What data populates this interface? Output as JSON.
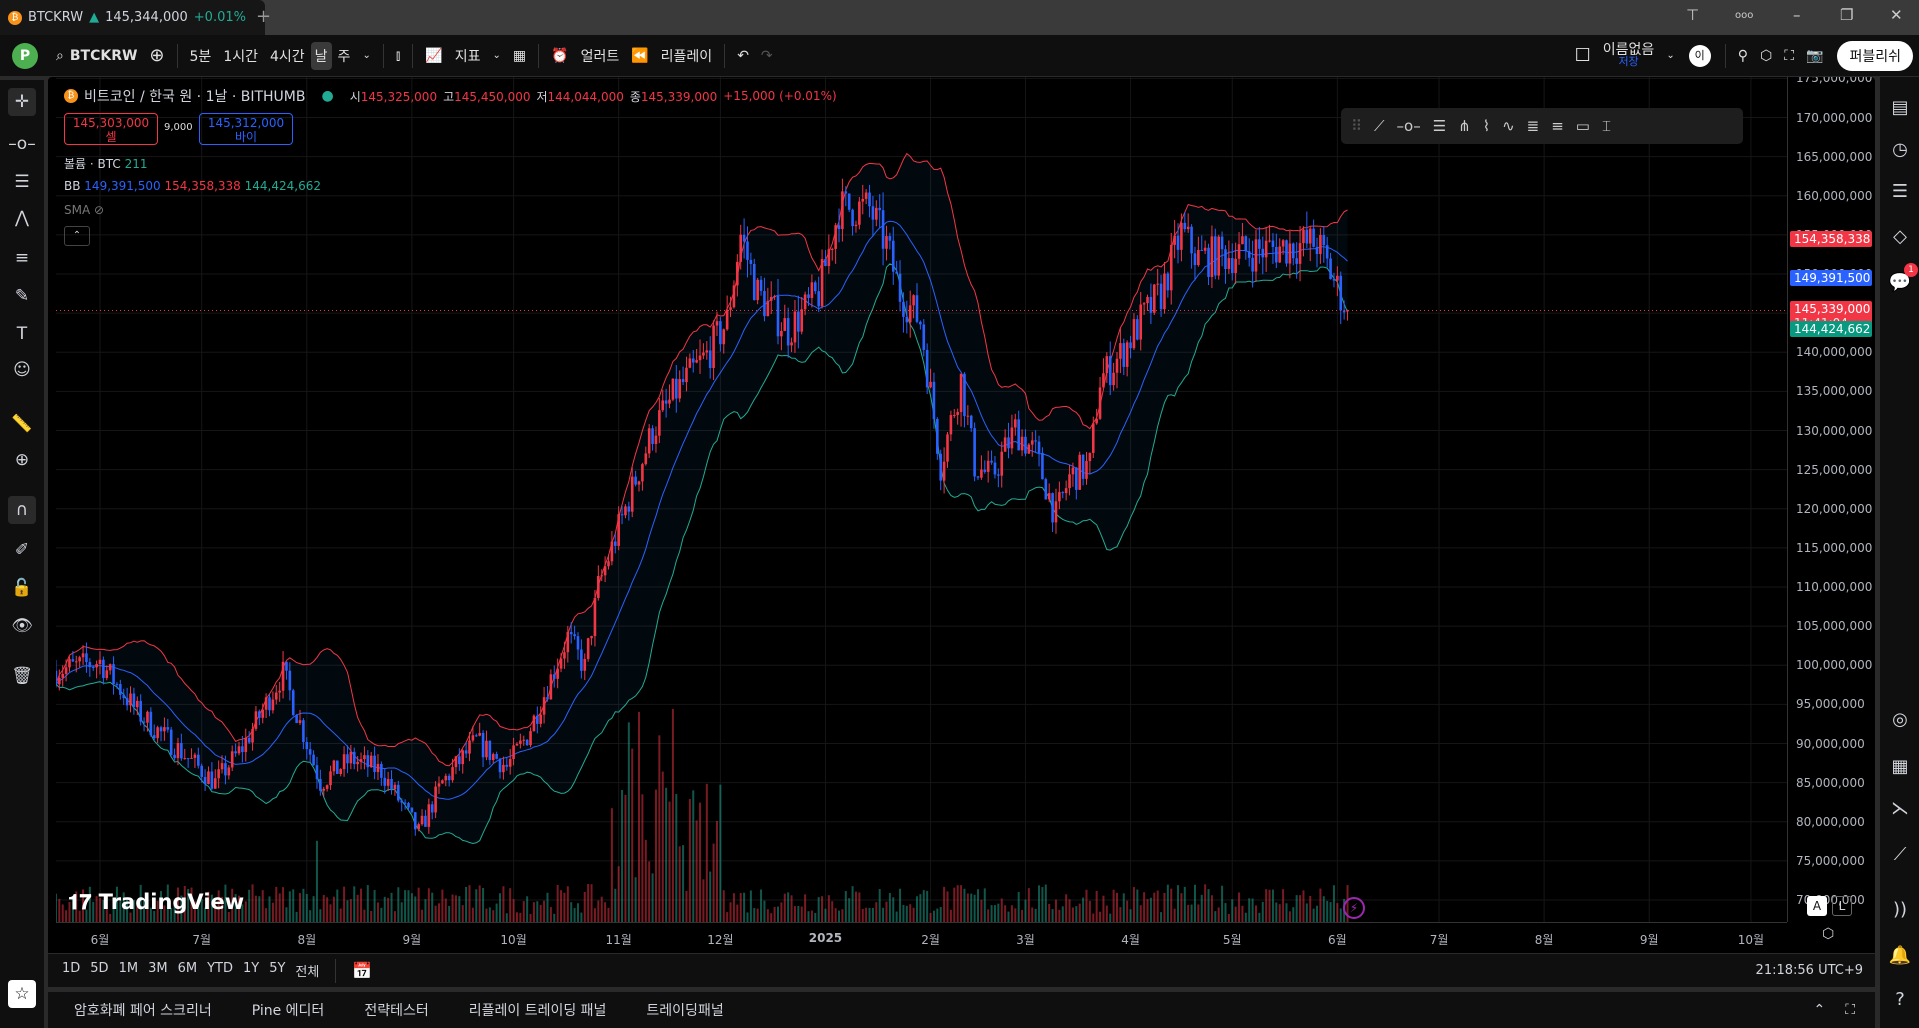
{
  "titlebar": {
    "symbol": "BTCKRW",
    "price": "145,344,000",
    "change": "+0.01%",
    "new_tab": "+",
    "win": {
      "min": "–",
      "max": "❐",
      "close": "✕",
      "more": "ooo"
    }
  },
  "toolbar": {
    "avatar": "P",
    "symbol": "BTCKRW",
    "intervals": [
      "5분",
      "1시간",
      "4시간",
      "날",
      "주"
    ],
    "active_interval": "날",
    "indicators": "지표",
    "alert": "얼러트",
    "replay": "리플레이",
    "layout_name": "이름없음",
    "layout_save": "저장",
    "user_initial": "이",
    "publish": "퍼블리쉬"
  },
  "legend": {
    "title": "비트코인 / 한국 원 · 1날 · BITHUMB",
    "o_label": "시",
    "o": "145,325,000",
    "h_label": "고",
    "h": "145,450,000",
    "l_label": "저",
    "l": "144,044,000",
    "c_label": "종",
    "c": "145,339,000",
    "chg": "+15,000 (+0.01%)",
    "sell_price": "145,303,000",
    "sell_label": "셀",
    "spread": "9,000",
    "buy_price": "145,312,000",
    "buy_label": "바이",
    "volume_label": "볼륨 · BTC",
    "volume_value": "211",
    "bb_label": "BB",
    "bb_basis": "149,391,500",
    "bb_upper": "154,358,338",
    "bb_lower": "144,424,662",
    "sma_label": "SMA"
  },
  "price_axis": {
    "labels": [
      "175,000,000",
      "170,000,000",
      "165,000,000",
      "160,000,000",
      "155,000,000",
      "150,000,000",
      "145,000,000",
      "140,000,000",
      "135,000,000",
      "130,000,000",
      "125,000,000",
      "120,000,000",
      "115,000,000",
      "110,000,000",
      "105,000,000",
      "100,000,000",
      "95,000,000",
      "90,000,000",
      "85,000,000",
      "80,000,000",
      "75,000,000",
      "70,000,000"
    ],
    "badge_upper": "154,358,338",
    "badge_basis": "149,391,500",
    "badge_last": "145,339,000",
    "badge_countdown": "11:41:04",
    "badge_lower": "144,424,662",
    "auto": "A",
    "log": "L"
  },
  "time_axis": {
    "labels": [
      "6월",
      "7월",
      "8월",
      "9월",
      "10월",
      "11월",
      "12월",
      "2025",
      "2월",
      "3월",
      "4월",
      "5월",
      "6월",
      "7월",
      "8월",
      "9월",
      "10월"
    ]
  },
  "range_bar": {
    "ranges": [
      "1D",
      "5D",
      "1M",
      "3M",
      "6M",
      "YTD",
      "1Y",
      "5Y",
      "전체"
    ],
    "clock": "21:18:56 UTC+9"
  },
  "bottom_tabs": [
    "암호화폐 페어 스크리너",
    "Pine 에디터",
    "전략테스터",
    "리플레이 트레이딩 패널",
    "트레이딩패널"
  ],
  "right_sidebar": {
    "notification_badge": "1"
  },
  "watermark": "TradingView",
  "colors": {
    "up": "#f23645",
    "down": "#2962ff",
    "bb_upper": "#f23645",
    "bb_basis": "#2962ff",
    "bb_lower": "#22ab94"
  },
  "chart_data": {
    "type": "candlestick",
    "interval": "1D",
    "units": "KRW (millions)",
    "ylim": [
      67,
      177
    ],
    "path": [
      [
        "2024-05-19",
        99.3
      ],
      [
        "2024-06-01",
        100.5
      ],
      [
        "2024-06-12",
        94
      ],
      [
        "2024-07-05",
        85
      ],
      [
        "2024-07-13",
        89.5
      ],
      [
        "2024-07-25",
        99
      ],
      [
        "2024-08-05",
        85
      ],
      [
        "2024-08-14",
        88
      ],
      [
        "2024-08-23",
        86.5
      ],
      [
        "2024-09-03",
        78.6
      ],
      [
        "2024-09-10",
        85
      ],
      [
        "2024-09-20",
        90.3
      ],
      [
        "2024-09-29",
        87
      ],
      [
        "2024-10-05",
        91
      ],
      [
        "2024-10-17",
        103.6
      ],
      [
        "2024-10-22",
        99.7
      ],
      [
        "2024-10-26",
        110
      ],
      [
        "2024-11-11",
        130
      ],
      [
        "2024-11-18",
        135
      ],
      [
        "2024-11-27",
        139.6
      ],
      [
        "2024-12-03",
        144
      ],
      [
        "2024-12-07",
        155
      ],
      [
        "2024-12-12",
        147.5
      ],
      [
        "2024-12-21",
        142.8
      ],
      [
        "2024-12-30",
        147.5
      ],
      [
        "2025-01-05",
        158.4
      ],
      [
        "2025-01-14",
        158.4
      ],
      [
        "2025-01-19",
        153.7
      ],
      [
        "2025-01-23",
        147.5
      ],
      [
        "2025-01-29",
        144
      ],
      [
        "2025-02-04",
        125.6
      ],
      [
        "2025-02-10",
        136.5
      ],
      [
        "2025-02-14",
        125.6
      ],
      [
        "2025-02-19",
        124
      ],
      [
        "2025-02-26",
        130.2
      ],
      [
        "2025-03-04",
        127
      ],
      [
        "2025-03-10",
        119
      ],
      [
        "2025-03-14",
        124
      ],
      [
        "2025-03-20",
        125.6
      ],
      [
        "2025-03-23",
        136.5
      ],
      [
        "2025-03-29",
        139.6
      ],
      [
        "2025-04-04",
        144
      ],
      [
        "2025-04-10",
        147.5
      ],
      [
        "2025-04-16",
        155.3
      ],
      [
        "2025-04-21",
        152
      ],
      [
        "2025-05-26",
        154
      ],
      [
        "2025-06-04",
        145.339
      ]
    ],
    "bollinger": {
      "length": 20,
      "mult": 2,
      "basis": 149391500,
      "upper": 154358338,
      "lower": 144424662
    },
    "last": {
      "open": 145325000,
      "high": 145450000,
      "low": 144044000,
      "close": 145339000,
      "volume": 211
    }
  }
}
